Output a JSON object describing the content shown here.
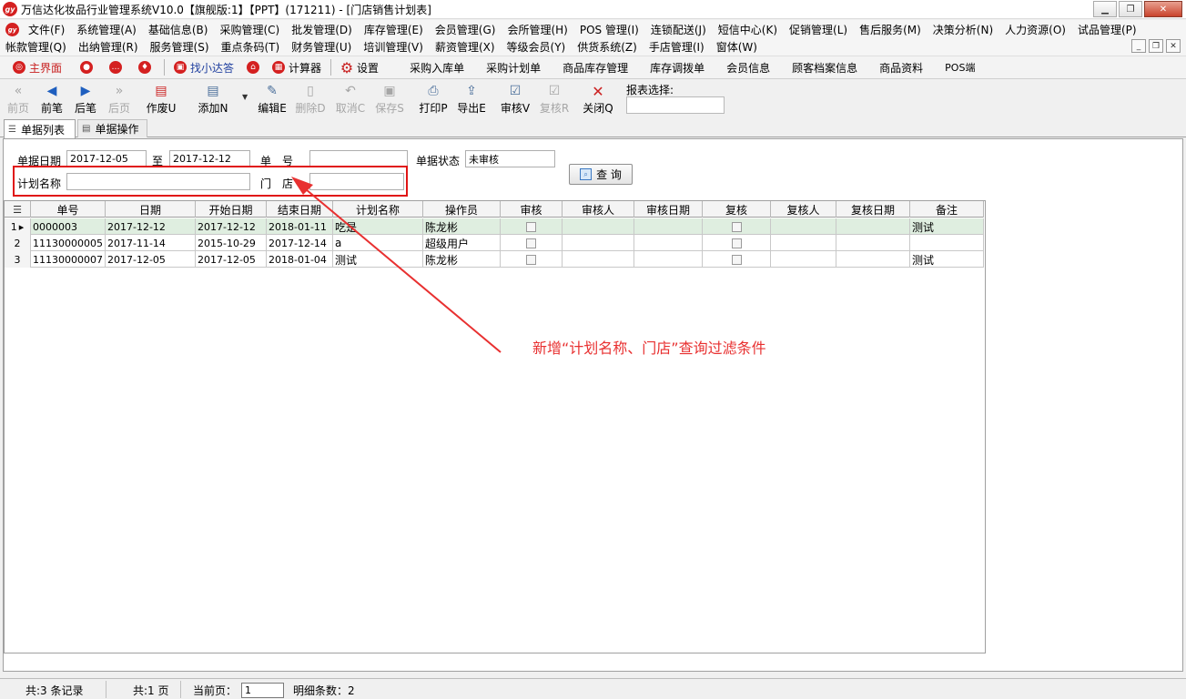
{
  "window": {
    "title": "万信达化妆品行业管理系统V10.0【旗舰版:1】【PPT】(171211) - [门店销售计划表]",
    "minimize_icon": "minimize-icon",
    "restore_icon": "restore-icon",
    "close_icon": "close-icon"
  },
  "menu": {
    "row1": [
      "文件(F)",
      "系统管理(A)",
      "基础信息(B)",
      "采购管理(C)",
      "批发管理(D)",
      "库存管理(E)",
      "会员管理(G)",
      "会所管理(H)",
      "POS 管理(I)",
      "连锁配送(J)",
      "短信中心(K)",
      "促销管理(L)",
      "售后服务(M)",
      "决策分析(N)",
      "人力资源(O)",
      "试品管理(P)"
    ],
    "row2": [
      "帐款管理(Q)",
      "出纳管理(R)",
      "服务管理(S)",
      "重点条码(T)",
      "财务管理(U)",
      "培训管理(V)",
      "薪资管理(X)",
      "等级会员(Y)",
      "供货系统(Z)",
      "手店管理(I)",
      "窗体(W)"
    ]
  },
  "quickbar": {
    "main": "主界面",
    "find": "找小达答",
    "calc": "计算器",
    "settings": "设置",
    "links": [
      "采购入库单",
      "采购计划单",
      "商品库存管理",
      "库存调拨单",
      "会员信息",
      "顾客档案信息",
      "商品资料",
      "POS端"
    ]
  },
  "toolbar": {
    "first": "前页",
    "prev": "前笔",
    "next": "后笔",
    "last": "后页",
    "void": "作废U",
    "add": "添加N",
    "edit": "编辑E",
    "delete": "删除D",
    "cancel": "取消C",
    "save": "保存S",
    "print": "打印P",
    "export": "导出E",
    "audit": "审核V",
    "reaudit": "复核R",
    "close": "关闭Q",
    "report_label": "报表选择:",
    "report_value": ""
  },
  "tabs": {
    "list": "单据列表",
    "operation": "单据操作"
  },
  "filter": {
    "date_label": "单据日期",
    "date_from": "2017-12-05",
    "to_label": "至",
    "date_to": "2017-12-12",
    "number_label": "单　号",
    "number_value": "",
    "status_label": "单据状态",
    "status_value": "未审核",
    "plan_label": "计划名称",
    "plan_value": "",
    "store_label": "门　店",
    "store_value": "",
    "query_button": "查 询"
  },
  "grid": {
    "columns": [
      "单号",
      "日期",
      "开始日期",
      "结束日期",
      "计划名称",
      "操作员",
      "审核",
      "审核人",
      "审核日期",
      "复核",
      "复核人",
      "复核日期",
      "备注"
    ],
    "rows": [
      {
        "num": "1",
        "indicator": "▸",
        "code": "0000003",
        "date": "2017-12-12",
        "start": "2017-12-12",
        "end": "2018-01-11",
        "plan": "吃是",
        "operator": "陈龙彬",
        "auditor": "",
        "audit_date": "",
        "reviewer": "",
        "review_date": "",
        "remark": "测试"
      },
      {
        "num": "2",
        "indicator": "",
        "code": "11130000005",
        "date": "2017-11-14",
        "start": "2015-10-29",
        "end": "2017-12-14",
        "plan": "a",
        "operator": "超级用户",
        "auditor": "",
        "audit_date": "",
        "reviewer": "",
        "review_date": "",
        "remark": ""
      },
      {
        "num": "3",
        "indicator": "",
        "code": "11130000007",
        "date": "2017-12-05",
        "start": "2017-12-05",
        "end": "2018-01-04",
        "plan": "测试",
        "operator": "陈龙彬",
        "auditor": "",
        "audit_date": "",
        "reviewer": "",
        "review_date": "",
        "remark": "测试"
      }
    ],
    "footer_count": "3"
  },
  "annotation": {
    "text": "新增“计划名称、门店”查询过滤条件",
    "color": "#e83030"
  },
  "status": {
    "records": "共:3 条记录",
    "pages": "共:1 页",
    "current_label": "当前页：",
    "current_value": "1",
    "detail": "明细条数：2"
  }
}
